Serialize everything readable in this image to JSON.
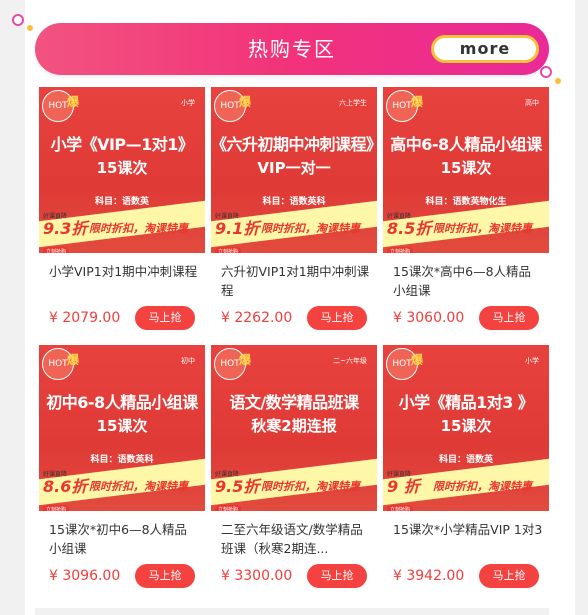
{
  "section": {
    "title": "热购专区",
    "more_label": "more"
  },
  "products": [
    {
      "name": "小学VIP1对1期中冲刺课程",
      "price": "¥ 2079.00",
      "buy_label": "马上抢",
      "image": {
        "hot": "HOT",
        "tag": "爆",
        "grade": "小学",
        "headline": "小学《VIP—1对1》",
        "sub": "15课次",
        "subject": "科目：语数英",
        "discount_label": "好课直降",
        "discount": "9.3折",
        "discount_btn": "立刻抢购",
        "slogan": "限时折扣，淘课特惠"
      }
    },
    {
      "name": "六升初VIP1对1期中冲刺课程",
      "price": "¥ 2262.00",
      "buy_label": "马上抢",
      "image": {
        "hot": "HOT",
        "tag": "爆",
        "grade": "六上学生",
        "headline": "《六升初期中冲刺课程》",
        "sub": "VIP一对一",
        "subject": "科目：语数英科",
        "discount_label": "好课直降",
        "discount": "9.1折",
        "discount_btn": "立刻抢购",
        "slogan": "限时折扣，淘课特惠"
      }
    },
    {
      "name": "15课次*高中6—8人精品小组课",
      "price": "¥ 3060.00",
      "buy_label": "马上抢",
      "image": {
        "hot": "HOT",
        "tag": "爆",
        "grade": "高中",
        "headline": "高中6-8人精品小组课",
        "sub": "15课次",
        "subject": "科目：语数英物化生",
        "discount_label": "好课直降",
        "discount": "8.5折",
        "discount_btn": "立刻抢购",
        "slogan": "限时折扣，淘课特惠"
      }
    },
    {
      "name": "15课次*初中6—8人精品小组课",
      "price": "¥ 3096.00",
      "buy_label": "马上抢",
      "image": {
        "hot": "HOT",
        "tag": "爆",
        "grade": "初中",
        "headline": "初中6-8人精品小组课",
        "sub": "15课次",
        "subject": "科目：语数英科",
        "discount_label": "好课直降",
        "discount": "8.6折",
        "discount_btn": "立刻抢购",
        "slogan": "限时折扣，淘课特惠"
      }
    },
    {
      "name": "二至六年级语文/数学精品班课（秋寒2期连...",
      "price": "¥ 3300.00",
      "buy_label": "马上抢",
      "image": {
        "hot": "HOT",
        "tag": "爆",
        "grade": "二~六年级",
        "headline": "语文/数学精品班课",
        "sub": "秋寒2期连报",
        "subject": "",
        "discount_label": "好课直降",
        "discount": "9.5折",
        "discount_btn": "立刻抢购",
        "slogan": "限时折扣，淘课特惠"
      }
    },
    {
      "name": "15课次*小学精品VIP 1对3",
      "price": "¥ 3942.00",
      "buy_label": "马上抢",
      "image": {
        "hot": "HOT",
        "tag": "爆",
        "grade": "小学",
        "headline": "小学《精品1对3 》",
        "sub": "15课次",
        "subject": "科目：语数英",
        "discount_label": "好课直降",
        "discount": "9 折",
        "discount_btn": "立刻抢购",
        "slogan": "限时折扣，淘课特惠"
      }
    }
  ]
}
